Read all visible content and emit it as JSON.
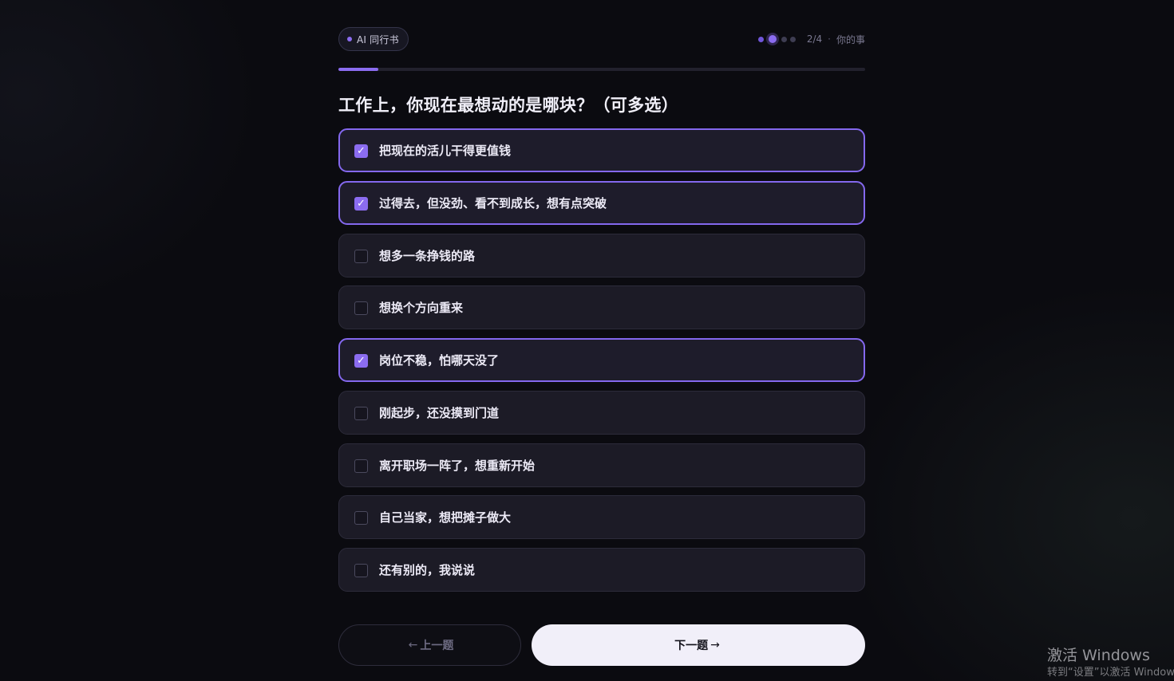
{
  "header": {
    "brand_label": "AI 同行书",
    "step": "2/4",
    "separator": "·",
    "section": "你的事",
    "steps_total": 4,
    "steps_current": 2,
    "progress_fraction": 0.076
  },
  "question": {
    "text": "工作上，你现在最想动的是哪块？（可多选）"
  },
  "options": [
    {
      "label": "把现在的活儿干得更值钱",
      "checked": true
    },
    {
      "label": "过得去，但没劲、看不到成长，想有点突破",
      "checked": true
    },
    {
      "label": "想多一条挣钱的路",
      "checked": false
    },
    {
      "label": "想换个方向重来",
      "checked": false
    },
    {
      "label": "岗位不稳，怕哪天没了",
      "checked": true
    },
    {
      "label": "刚起步，还没摸到门道",
      "checked": false
    },
    {
      "label": "离开职场一阵了，想重新开始",
      "checked": false
    },
    {
      "label": "自己当家，想把摊子做大",
      "checked": false
    },
    {
      "label": "还有别的，我说说",
      "checked": false
    }
  ],
  "nav": {
    "prev_arrow": "←",
    "prev_label": "上一题",
    "next_label": "下一题",
    "next_arrow": "→"
  },
  "watermark": {
    "title": "激活 Windows",
    "subtitle": "转到“设置”以激活 Windows。"
  },
  "colors": {
    "accent": "#8b6cf0",
    "background": "#0b0b10",
    "card": "#1c1b26",
    "next_button": "#f1eff9"
  },
  "icons": {
    "check": "check-icon",
    "step_dots": "step-dot-icon"
  }
}
